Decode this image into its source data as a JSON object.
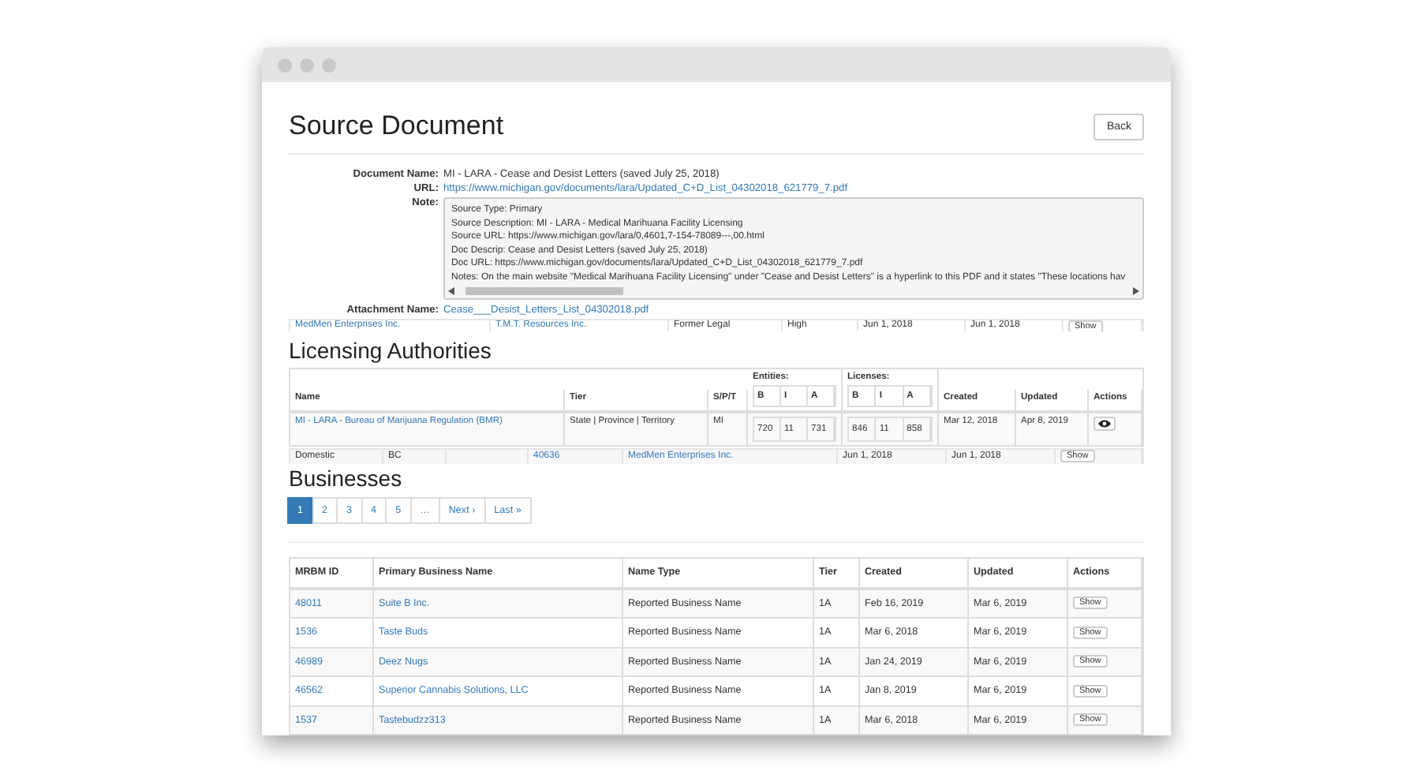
{
  "page": {
    "title": "Source Document",
    "back_button": "Back"
  },
  "document": {
    "fields": [
      {
        "kind": "text",
        "label": "Document Name:",
        "value": "MI - LARA - Cease and Desist Letters (saved July 25, 2018)"
      },
      {
        "kind": "link",
        "label": "URL:",
        "value": "https://www.michigan.gov/documents/lara/Updated_C+D_List_04302018_621779_7.pdf"
      },
      {
        "kind": "note",
        "label": "Note:",
        "lines": [
          "Source Type: Primary",
          "Source Description: MI - LARA - Medical Marihuana Facility Licensing",
          "Source URL: https://www.michigan.gov/lara/0,4601,7-154-78089---,00.html",
          "Doc Descrip: Cease and Desist Letters (saved July 25, 2018)",
          "Doc URL: https://www.michigan.gov/documents/lara/Updated_C+D_List_04302018_621779_7.pdf",
          "Notes: On the main website \"Medical Marihuana Facility Licensing\" under \"Cease and Desist Letters\" is a hyperlink to this PDF and it states \"These locations hav"
        ]
      },
      {
        "kind": "link",
        "label": "Attachment Name:",
        "value": "Cease___Desist_Letters_List_04302018.pdf"
      }
    ]
  },
  "partial_row_1": {
    "cells": [
      {
        "kind": "link",
        "text": "MedMen Enterprises Inc."
      },
      {
        "kind": "link",
        "text": "T.M.T. Resources Inc."
      },
      {
        "kind": "text",
        "text": "Former Legal"
      },
      {
        "kind": "text",
        "text": "High"
      },
      {
        "kind": "text",
        "text": "Jun 1, 2018"
      },
      {
        "kind": "text",
        "text": "Jun 1, 2018"
      },
      {
        "kind": "button",
        "text": "Show"
      }
    ]
  },
  "licensing_authorities": {
    "heading": "Licensing Authorities",
    "columns": [
      "Name",
      "Tier",
      "S/P/T",
      "Created",
      "Updated",
      "Actions"
    ],
    "entities": {
      "label": "Entities:",
      "columns": [
        "B",
        "I",
        "A"
      ]
    },
    "licenses": {
      "label": "Licenses:",
      "columns": [
        "B",
        "I",
        "A"
      ]
    },
    "rows": [
      {
        "name": "MI - LARA - Bureau of Marijuana Regulation (BMR)",
        "tier": "State | Province | Territory",
        "spt": "MI",
        "entities": [
          "720",
          "11",
          "731"
        ],
        "licenses": [
          "846",
          "11",
          "858"
        ],
        "created": "Mar 12, 2018",
        "updated": "Apr 8, 2019"
      }
    ]
  },
  "partial_row_2": {
    "cells": [
      {
        "kind": "text",
        "text": "Domestic"
      },
      {
        "kind": "text",
        "text": "BC"
      },
      {
        "kind": "empty",
        "text": ""
      },
      {
        "kind": "link",
        "text": "40636"
      },
      {
        "kind": "link",
        "text": "MedMen Enterprises Inc."
      },
      {
        "kind": "text",
        "text": "Jun 1, 2018"
      },
      {
        "kind": "text",
        "text": "Jun 1, 2018"
      },
      {
        "kind": "button",
        "text": "Show"
      }
    ]
  },
  "businesses": {
    "heading": "Businesses",
    "pagination": [
      {
        "label": "1",
        "selected": true
      },
      {
        "label": "2",
        "selected": false
      },
      {
        "label": "3",
        "selected": false
      },
      {
        "label": "4",
        "selected": false
      },
      {
        "label": "5",
        "selected": false
      },
      {
        "label": "…",
        "selected": false
      },
      {
        "label": "Next ›",
        "selected": false
      },
      {
        "label": "Last »",
        "selected": false
      }
    ],
    "columns": [
      "MRBM ID",
      "Primary Business Name",
      "Name Type",
      "Tier",
      "Created",
      "Updated",
      "Actions"
    ],
    "rows": [
      {
        "id": "48011",
        "name": "Suite B Inc.",
        "name_type": "Reported Business Name",
        "tier": "1A",
        "created": "Feb 16, 2019",
        "updated": "Mar 6, 2019",
        "action": "Show"
      },
      {
        "id": "1536",
        "name": "Taste Buds",
        "name_type": "Reported Business Name",
        "tier": "1A",
        "created": "Mar 6, 2018",
        "updated": "Mar 6, 2019",
        "action": "Show"
      },
      {
        "id": "46989",
        "name": "Deez Nugs",
        "name_type": "Reported Business Name",
        "tier": "1A",
        "created": "Jan 24, 2019",
        "updated": "Mar 6, 2019",
        "action": "Show"
      },
      {
        "id": "46562",
        "name": "Superior Cannabis Solutions, LLC",
        "name_type": "Reported Business Name",
        "tier": "1A",
        "created": "Jan 8, 2019",
        "updated": "Mar 6, 2019",
        "action": "Show"
      },
      {
        "id": "1537",
        "name": "Tastebudzz313",
        "name_type": "Reported Business Name",
        "tier": "1A",
        "created": "Mar 6, 2018",
        "updated": "Mar 6, 2019",
        "action": "Show"
      }
    ]
  }
}
